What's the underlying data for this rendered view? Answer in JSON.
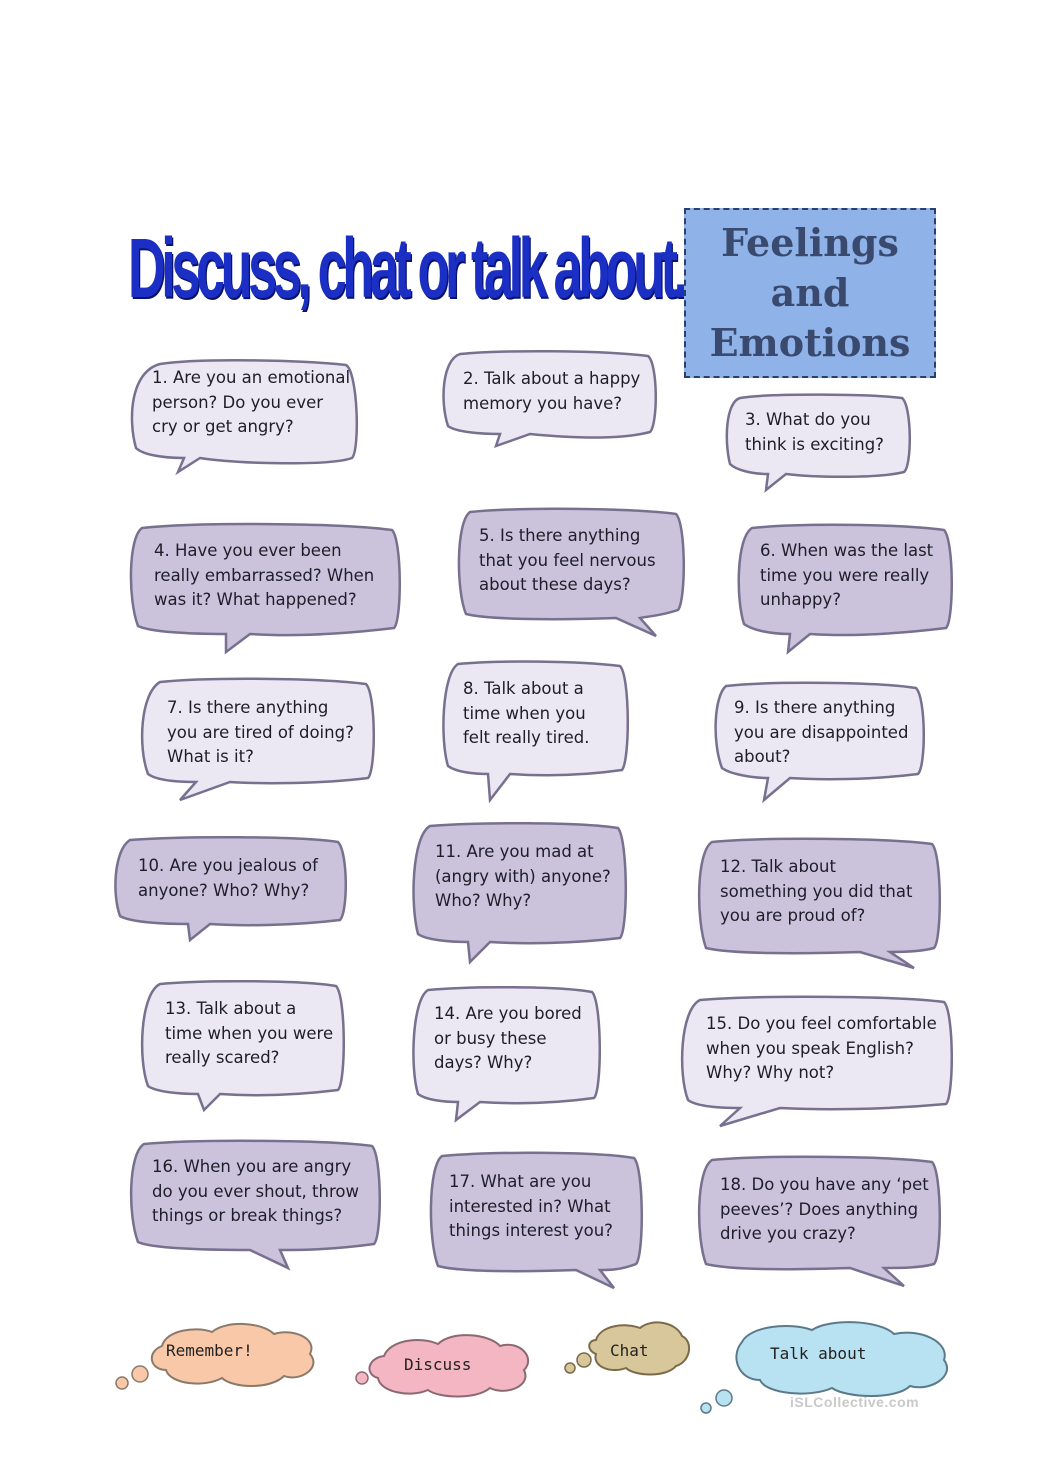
{
  "title": "Discuss, chat or talk about...",
  "topic": [
    "Feelings",
    "and",
    "Emotions"
  ],
  "colors": {
    "title_blue": "#1b2fc4",
    "topic_box": "#8fb3e8",
    "bubble_light": "#ebe7f3",
    "bubble_dark": "#cbc2dc",
    "bubble_border": "#77708e",
    "cloud_orange": "#f8c8a8",
    "cloud_pink": "#f4b6c2",
    "cloud_tan": "#d9c79c",
    "cloud_blue": "#b8e2f2"
  },
  "questions": [
    {
      "n": 1,
      "text": "1. Are you an emotional\nperson? Do you ever\ncry or get angry?"
    },
    {
      "n": 2,
      "text": "2. Talk about a happy\nmemory you have?"
    },
    {
      "n": 3,
      "text": "3. What do you\nthink is exciting?"
    },
    {
      "n": 4,
      "text": "4. Have you ever been\nreally embarrassed? When\nwas it? What happened?"
    },
    {
      "n": 5,
      "text": "5. Is there anything\nthat you feel nervous\nabout these days?"
    },
    {
      "n": 6,
      "text": "6. When was the last\ntime you were really\nunhappy?"
    },
    {
      "n": 7,
      "text": "7. Is there anything\nyou are tired of doing?\nWhat is it?"
    },
    {
      "n": 8,
      "text": "8. Talk about a\ntime when you\nfelt really tired."
    },
    {
      "n": 9,
      "text": "9. Is there anything\nyou are disappointed\nabout?"
    },
    {
      "n": 10,
      "text": "10. Are you jealous of\nanyone? Who? Why?"
    },
    {
      "n": 11,
      "text": "11. Are you mad at\n(angry with) anyone?\nWho? Why?"
    },
    {
      "n": 12,
      "text": "12. Talk about\nsomething you did that\nyou are proud of?"
    },
    {
      "n": 13,
      "text": "13. Talk about a\ntime when you were\nreally scared?"
    },
    {
      "n": 14,
      "text": "14. Are you bored\nor busy these\ndays? Why?"
    },
    {
      "n": 15,
      "text": "15. Do you feel comfortable\nwhen you speak English?\nWhy? Why not?"
    },
    {
      "n": 16,
      "text": "16. When you are angry\ndo you ever shout, throw\nthings or break things?"
    },
    {
      "n": 17,
      "text": "17. What are you\ninterested in? What\nthings interest you?"
    },
    {
      "n": 18,
      "text": "18. Do you have any ‘pet\npeeves’? Does anything\ndrive you crazy?"
    }
  ],
  "clouds": [
    "Remember!",
    "Discuss",
    "Chat",
    "Talk about"
  ],
  "watermark": "iSLCollective.com"
}
